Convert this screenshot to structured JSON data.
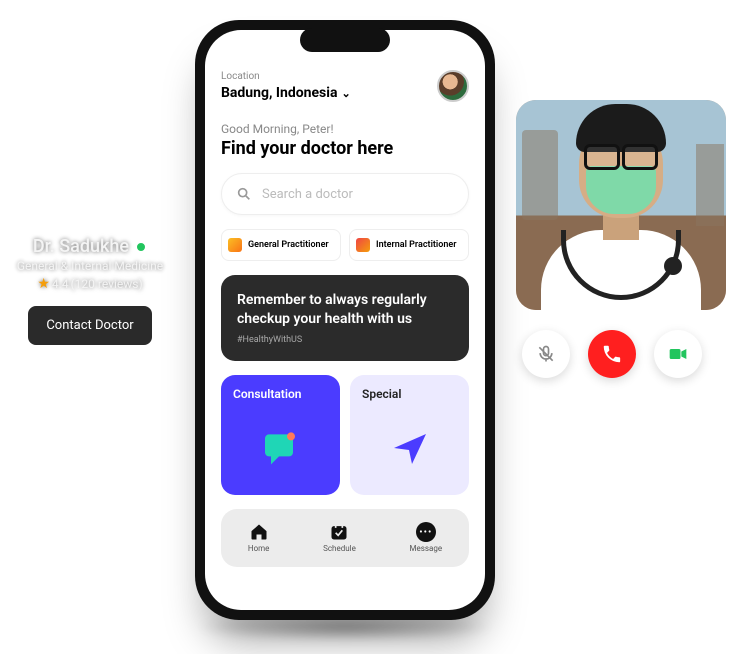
{
  "doctor_card": {
    "name": "Dr. Sadukhe",
    "specialty": "General & Internal Medicine",
    "rating_value": "4.4",
    "reviews": "(120 reviews)",
    "contact_label": "Contact Doctor"
  },
  "phone": {
    "location_label": "Location",
    "location_value": "Badung, Indonesia",
    "greeting": "Good Morning, Peter!",
    "headline": "Find your doctor here",
    "search_placeholder": "Search a doctor",
    "chips": {
      "general": "General Practitioner",
      "internal": "Internal Practitioner"
    },
    "banner": {
      "title": "Remember to always regularly checkup your health with us",
      "tag": "#HealthyWithUS"
    },
    "cards": {
      "consultation": "Consultation",
      "special": "Special"
    },
    "tabs": {
      "home": "Home",
      "schedule": "Schedule",
      "message": "Message"
    }
  },
  "call": {
    "mute": "mute",
    "hangup": "hangup",
    "video": "video"
  }
}
